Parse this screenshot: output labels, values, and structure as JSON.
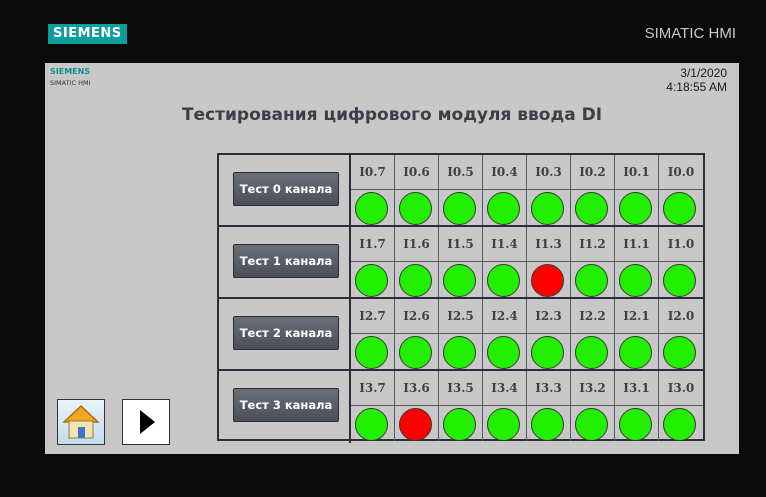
{
  "header": {
    "brand": "SIEMENS",
    "product": "SIMATIC HMI"
  },
  "screen": {
    "brand_small": "SIEMENS",
    "model_small": "SIMATIC HMI",
    "date": "3/1/2020",
    "time": "4:18:55 AM",
    "title": "Тестирования цифрового модуля ввода DI"
  },
  "rows": [
    {
      "button": "Тест 0 канала",
      "labels": [
        "I0.7",
        "I0.6",
        "I0.5",
        "I0.4",
        "I0.3",
        "I0.2",
        "I0.1",
        "I0.0"
      ],
      "states": [
        "on",
        "on",
        "on",
        "on",
        "on",
        "on",
        "on",
        "on"
      ]
    },
    {
      "button": "Тест 1 канала",
      "labels": [
        "I1.7",
        "I1.6",
        "I1.5",
        "I1.4",
        "I1.3",
        "I1.2",
        "I1.1",
        "I1.0"
      ],
      "states": [
        "on",
        "on",
        "on",
        "on",
        "fault",
        "on",
        "on",
        "on"
      ]
    },
    {
      "button": "Тест 2 канала",
      "labels": [
        "I2.7",
        "I2.6",
        "I2.5",
        "I2.4",
        "I2.3",
        "I2.2",
        "I2.1",
        "I2.0"
      ],
      "states": [
        "on",
        "on",
        "on",
        "on",
        "on",
        "on",
        "on",
        "on"
      ]
    },
    {
      "button": "Тест 3 канала",
      "labels": [
        "I3.7",
        "I3.6",
        "I3.5",
        "I3.4",
        "I3.3",
        "I3.2",
        "I3.1",
        "I3.0"
      ],
      "states": [
        "on",
        "fault",
        "on",
        "on",
        "on",
        "on",
        "on",
        "on"
      ]
    }
  ],
  "colors": {
    "on": "#22f000",
    "fault": "#ff0000",
    "brand": "#0e9c9c"
  },
  "nav": {
    "home_icon": "home-icon",
    "next_icon": "play-arrow-icon"
  }
}
